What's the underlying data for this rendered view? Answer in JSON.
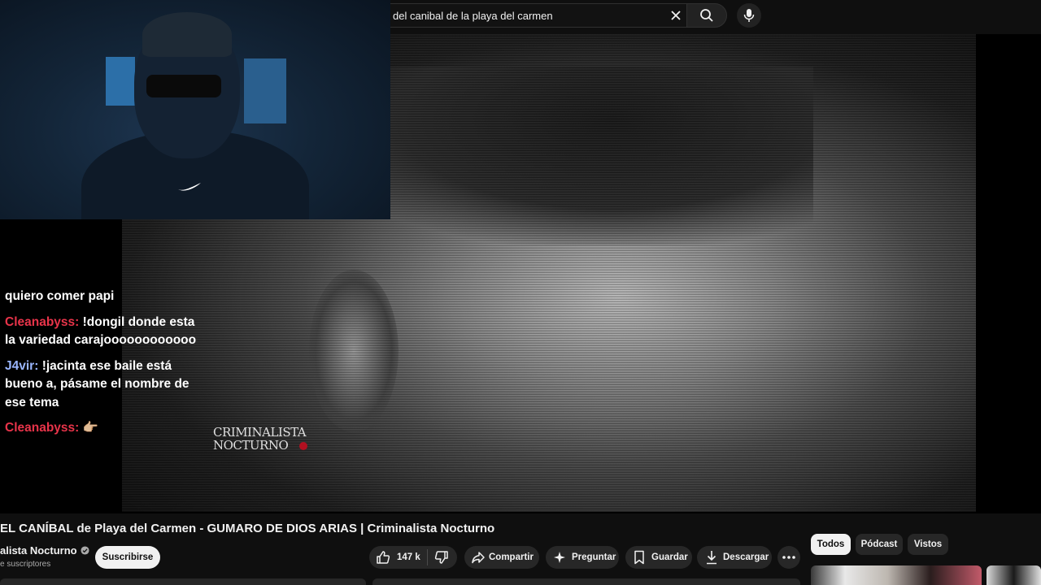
{
  "search": {
    "query": "del canibal de la playa del carmen",
    "clear_icon": "close-icon",
    "search_icon": "search-icon",
    "mic_icon": "mic-icon"
  },
  "chat": {
    "messages": [
      {
        "user": "",
        "text": "quiero comer papi"
      },
      {
        "user": "Cleanabyss:",
        "text": "!dongil donde esta la variedad carajoooooooooooo"
      },
      {
        "user": "J4vir:",
        "text": "!jacinta ese baile está bueno a, pásame el nombre de ese tema"
      },
      {
        "user": "Cleanabyss:",
        "text": "👉🏼"
      }
    ]
  },
  "watermark": {
    "line1": "Criminalista",
    "line2": "Nocturno"
  },
  "video": {
    "title": "EL CANÍBAL de Playa del Carmen - GUMARO DE DIOS ARIAS | Criminalista Nocturno",
    "channel": "alista Nocturno",
    "subscribers": "e suscriptores",
    "subscribe_label": "Suscribirse",
    "likes": "147 k",
    "share_label": "Compartir",
    "ask_label": "Preguntar",
    "save_label": "Guardar",
    "download_label": "Descargar"
  },
  "chips": [
    {
      "label": "Todos",
      "active": true
    },
    {
      "label": "Pódcast",
      "active": false
    },
    {
      "label": "Vistos",
      "active": false
    }
  ],
  "colors": {
    "background": "#0f0f0f",
    "chat_red": "#e8344a",
    "chat_blue": "#9ab6ff",
    "pill": "#272727"
  }
}
